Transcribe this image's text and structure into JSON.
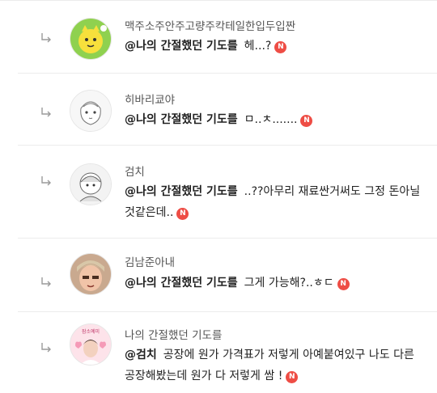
{
  "comments": [
    {
      "nickname": "맥주소주안주고량주칵테일한입두입짠",
      "mention": "@나의 간절했던 기도를",
      "text": "헤...?",
      "badge": "N",
      "avatar_icon": "yellow-character-avatar"
    },
    {
      "nickname": "히바리쿄야",
      "mention": "@나의 간절했던 기도를",
      "text": "ㅁ..ㅊ.......",
      "badge": "N",
      "avatar_icon": "drawn-character-avatar"
    },
    {
      "nickname": "검치",
      "mention": "@나의 간절했던 기도를",
      "text": "..??아무리 재료싼거써도 그정 돈아닐것같은데..",
      "badge": "N",
      "avatar_icon": "sketch-character-avatar"
    },
    {
      "nickname": "김남준아내",
      "mention": "@나의 간절했던 기도를",
      "text": "그게 가능해?..ㅎㄷ",
      "badge": "N",
      "avatar_icon": "person-photo-avatar"
    },
    {
      "nickname": "나의 간절했던 기도를",
      "mention": "@검치",
      "text": "공장에 원가 가격표가 저렇게 아예붙여있구 나도 다른공장해봤는데 원가 다 저렇게 쌈 !",
      "badge": "N",
      "avatar_icon": "pink-photo-avatar",
      "avatar_label": "잠소예미"
    }
  ],
  "colors": {
    "badge": "#ee4d45",
    "divider": "#ececec",
    "nickname": "#555555",
    "text": "#222222"
  }
}
